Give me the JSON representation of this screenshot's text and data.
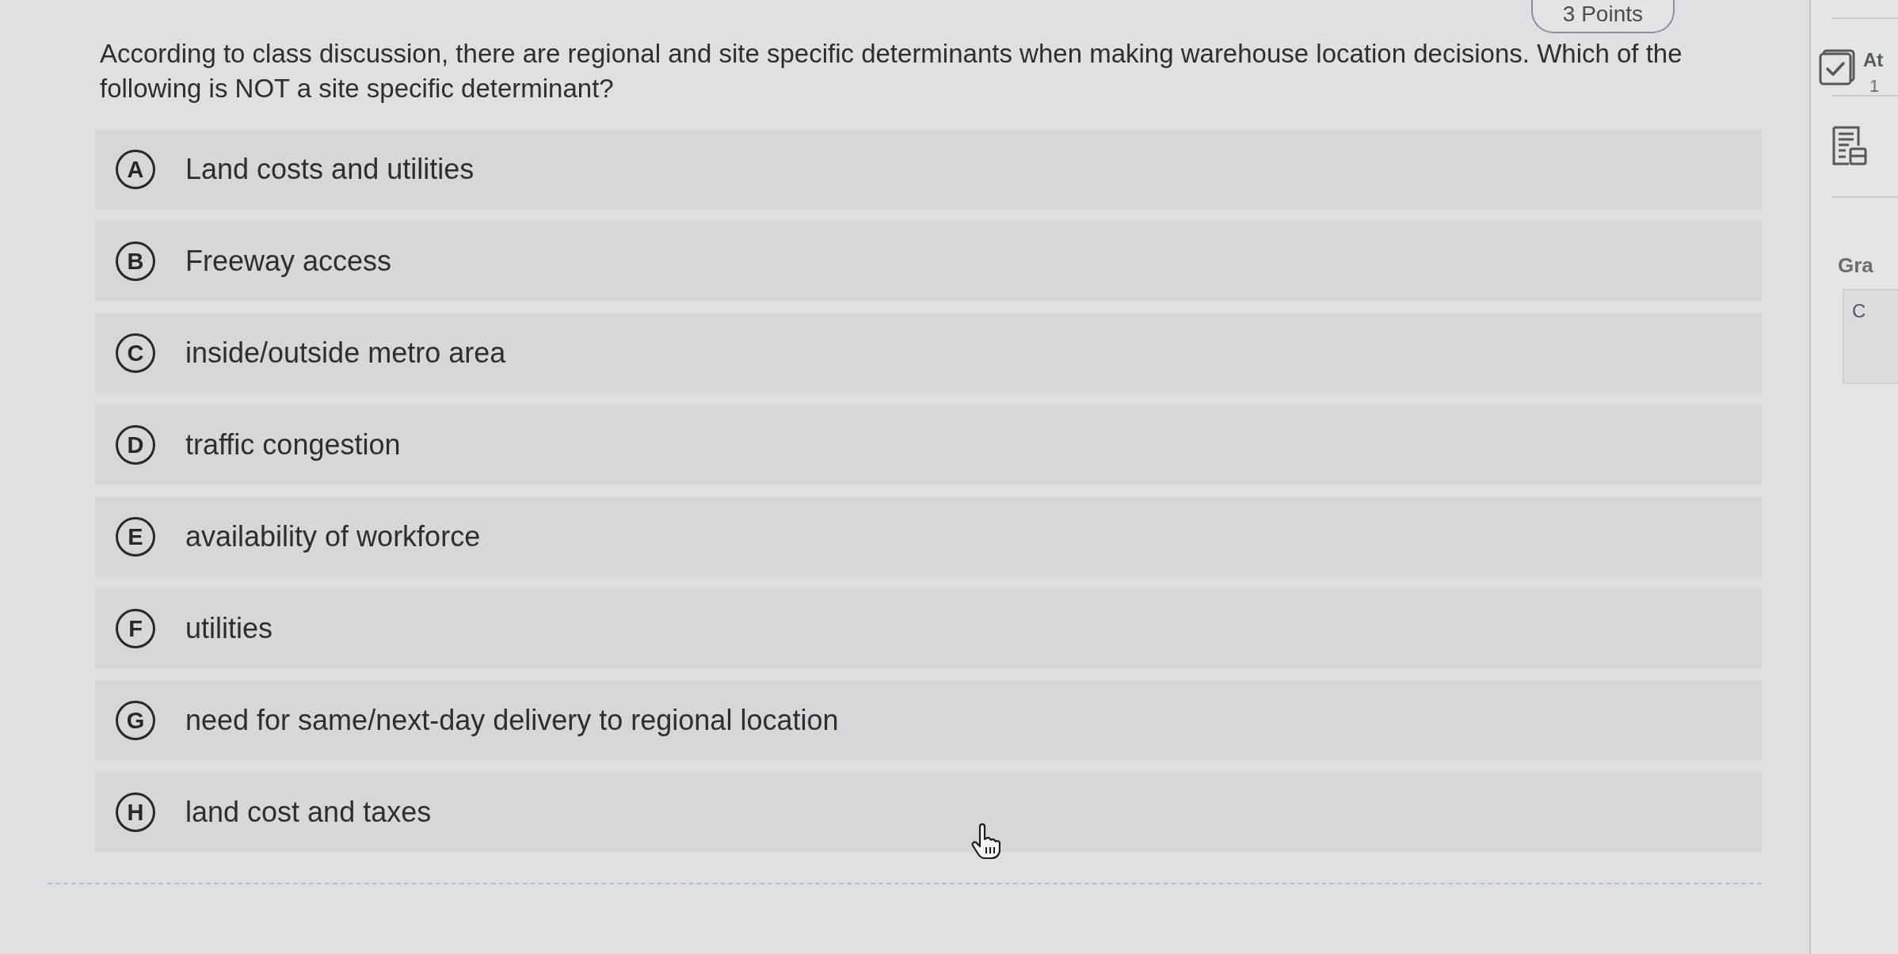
{
  "points_badge": "3 Points",
  "question": "According to class discussion, there are regional and site specific determinants when making warehouse location decisions. Which of the following is NOT a site specific determinant?",
  "options": [
    {
      "letter": "A",
      "text": "Land costs and utilities",
      "selected": false
    },
    {
      "letter": "B",
      "text": "Freeway access",
      "selected": false
    },
    {
      "letter": "C",
      "text": "inside/outside metro area",
      "selected": false
    },
    {
      "letter": "D",
      "text": "traffic congestion",
      "selected": false
    },
    {
      "letter": "E",
      "text": "availability of workforce",
      "selected": false
    },
    {
      "letter": "F",
      "text": "utilities",
      "selected": false
    },
    {
      "letter": "G",
      "text": "need for same/next-day delivery to regional location",
      "selected": false
    },
    {
      "letter": "H",
      "text": "land cost and taxes",
      "selected": false
    }
  ],
  "sidebar": {
    "attempts_label": "At",
    "attempts_value": "1",
    "grade_label": "Gra",
    "grade_value": "C"
  }
}
